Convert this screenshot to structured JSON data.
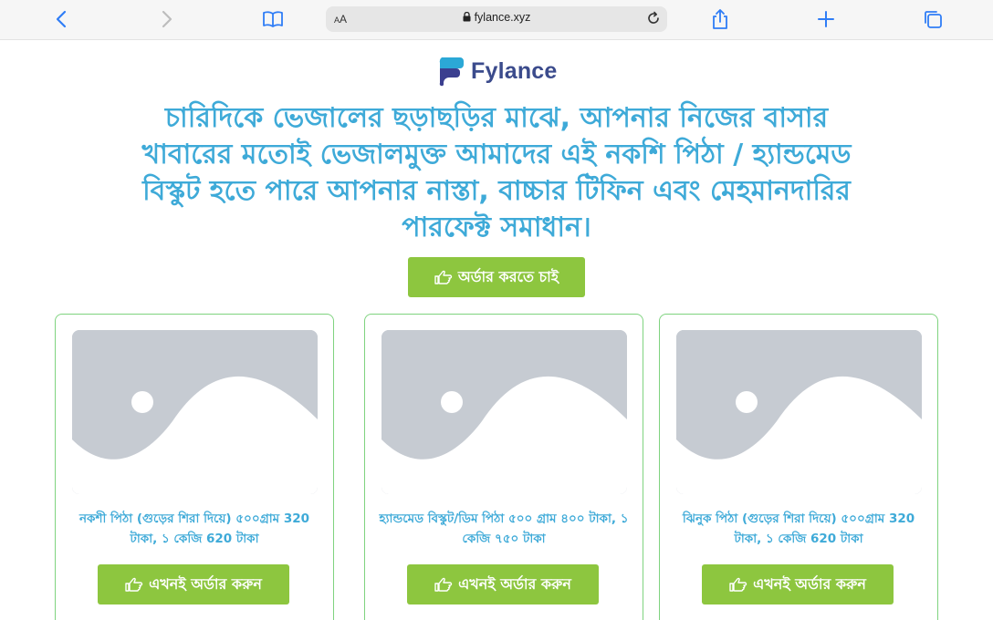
{
  "browser": {
    "text_size_label": "AA",
    "url": "fylance.xyz"
  },
  "logo": {
    "name": "Fylance",
    "colors": {
      "mark_top": "#2ba8d6",
      "mark_bottom": "#3b3f8f",
      "text": "#3b4b8c"
    }
  },
  "headline": "চারিদিকে ভেজালের ছড়াছড়ির মাঝে, আপনার নিজের বাসার খাবারের মতোই ভেজালমুক্ত আমাদের এই নকশি পিঠা / হ্যান্ডমেড বিস্কুট হতে পারে আপনার নাস্তা, বাচ্চার টিফিন এবং মেহমানদারির পারফেক্ট সমাধান।",
  "main_cta": {
    "label": "অর্ডার করতে চাই",
    "icon": "hand-pointing-icon"
  },
  "products": [
    {
      "title": "নকশী পিঠা (গুড়ের শিরা দিয়ে) ৫০০গ্রাম 320 টাকা, ১ কেজি 620 টাকা",
      "button_label": "এখনই অর্ডার করুন"
    },
    {
      "title": "হ্যান্ডমেড বিস্কুট/ডিম পিঠা ৫০০ গ্রাম ৪০০ টাকা, ১ কেজি ৭৫০ টাকা",
      "button_label": "এখনই অর্ডার করুন"
    },
    {
      "title": "ঝিনুক পিঠা (গুড়ের শিরা দিয়ে) ৫০০গ্রাম 320 টাকা, ১ কেজি 620 টাকা",
      "button_label": "এখনই অর্ডার করুন"
    }
  ],
  "colors": {
    "accent_text": "#3eaad8",
    "button": "#8dc63f",
    "card_border": "#7fd37f",
    "placeholder": "#c6cbd2"
  }
}
